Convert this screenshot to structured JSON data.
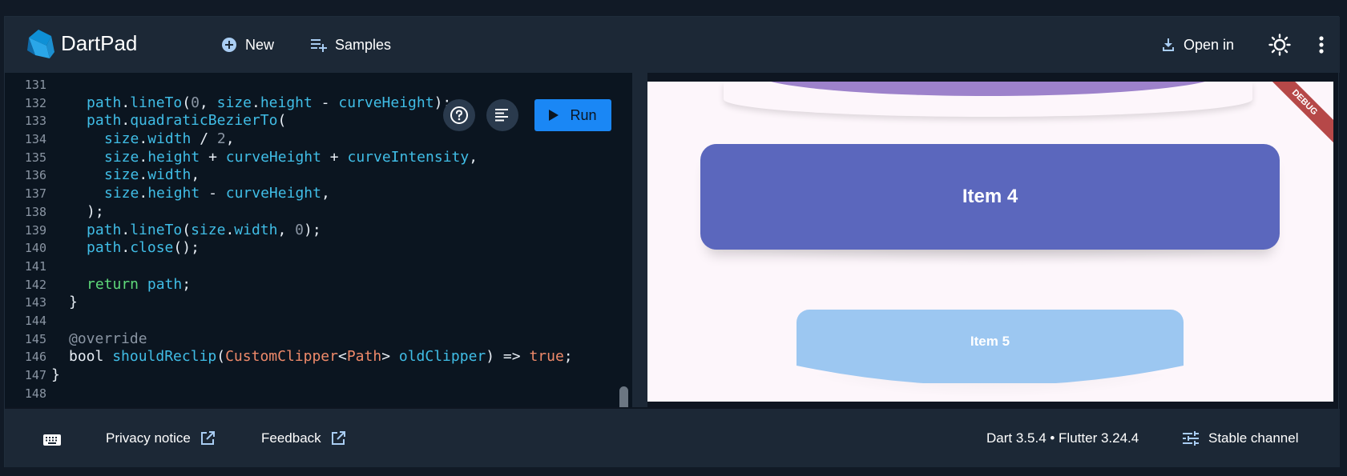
{
  "header": {
    "app_title": "DartPad",
    "new_label": "New",
    "samples_label": "Samples",
    "open_in_label": "Open in"
  },
  "editor": {
    "run_label": "Run",
    "lines": [
      {
        "n": "131"
      },
      {
        "n": "132"
      },
      {
        "n": "133"
      },
      {
        "n": "134"
      },
      {
        "n": "135"
      },
      {
        "n": "136"
      },
      {
        "n": "137"
      },
      {
        "n": "138"
      },
      {
        "n": "139"
      },
      {
        "n": "140"
      },
      {
        "n": "141"
      },
      {
        "n": "142"
      },
      {
        "n": "143"
      },
      {
        "n": "144"
      },
      {
        "n": "145"
      },
      {
        "n": "146"
      },
      {
        "n": "147"
      },
      {
        "n": "148"
      }
    ],
    "code": {
      "l132": [
        "path",
        ".",
        "lineTo",
        "(",
        "0",
        ", ",
        "size",
        ".",
        "height",
        " - ",
        "curveHeight",
        ");"
      ],
      "l133": [
        "path",
        ".",
        "quadraticBezierTo",
        "("
      ],
      "l134": [
        "size",
        ".",
        "width",
        " / ",
        "2",
        ","
      ],
      "l135": [
        "size",
        ".",
        "height",
        " + ",
        "curveHeight",
        " + ",
        "curveIntensity",
        ","
      ],
      "l136": [
        "size",
        ".",
        "width",
        ","
      ],
      "l137": [
        "size",
        ".",
        "height",
        " - ",
        "curveHeight",
        ","
      ],
      "l138": [
        ");"
      ],
      "l139": [
        "path",
        ".",
        "lineTo",
        "(",
        "size",
        ".",
        "width",
        ", ",
        "0",
        ");"
      ],
      "l140": [
        "path",
        ".",
        "close",
        "();"
      ],
      "l142": [
        "return",
        " ",
        "path",
        ";"
      ],
      "l143": [
        "}"
      ],
      "l145": [
        "@override"
      ],
      "l146": [
        "bool",
        " ",
        "shouldReclip",
        "(",
        "CustomClipper",
        "<",
        "Path",
        "> ",
        "oldClipper",
        ") => ",
        "true",
        ";"
      ],
      "l147": [
        "}"
      ]
    }
  },
  "preview": {
    "item4_label": "Item 4",
    "item5_label": "Item 5",
    "debug_label": "DEBUG"
  },
  "footer": {
    "privacy_label": "Privacy notice",
    "feedback_label": "Feedback",
    "version_label": "Dart 3.5.4 • Flutter 3.24.4",
    "channel_label": "Stable channel"
  },
  "colors": {
    "accent": "#1a87f5",
    "item4": "#5b67bd",
    "item5": "#9cc7f1",
    "item3": "#9d82cb",
    "debug": "#b64848"
  }
}
